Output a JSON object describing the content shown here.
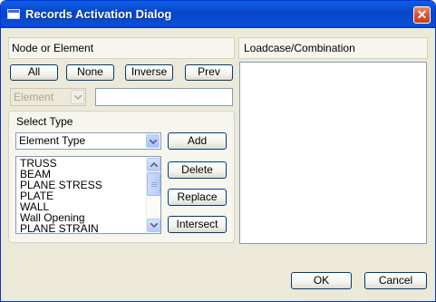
{
  "window": {
    "title": "Records Activation Dialog"
  },
  "left_panel": {
    "header": "Node or Element",
    "buttons": {
      "all": "All",
      "none": "None",
      "inverse": "Inverse",
      "prev": "Prev"
    },
    "element_combo": {
      "value": "Element",
      "enabled": false
    },
    "element_text": {
      "value": ""
    }
  },
  "select_type": {
    "label": "Select Type",
    "combo_value": "Element Type",
    "list_items": [
      "TRUSS",
      "BEAM",
      "PLANE STRESS",
      "PLATE",
      "WALL",
      "Wall Opening",
      "PLANE STRAIN"
    ],
    "buttons": {
      "add": "Add",
      "delete": "Delete",
      "replace": "Replace",
      "intersect": "Intersect"
    }
  },
  "right_panel": {
    "header": "Loadcase/Combination",
    "items": []
  },
  "footer": {
    "ok": "OK",
    "cancel": "Cancel"
  },
  "colors": {
    "titlebar": "#0a5fe4",
    "dialog_bg": "#ece9d8",
    "panel_bg": "#f6f5ee",
    "button_border": "#003c74"
  },
  "icons": {
    "close": "close-icon",
    "dropdown": "chevron-down-icon",
    "scroll_up": "arrow-up-icon",
    "scroll_down": "arrow-down-icon"
  }
}
